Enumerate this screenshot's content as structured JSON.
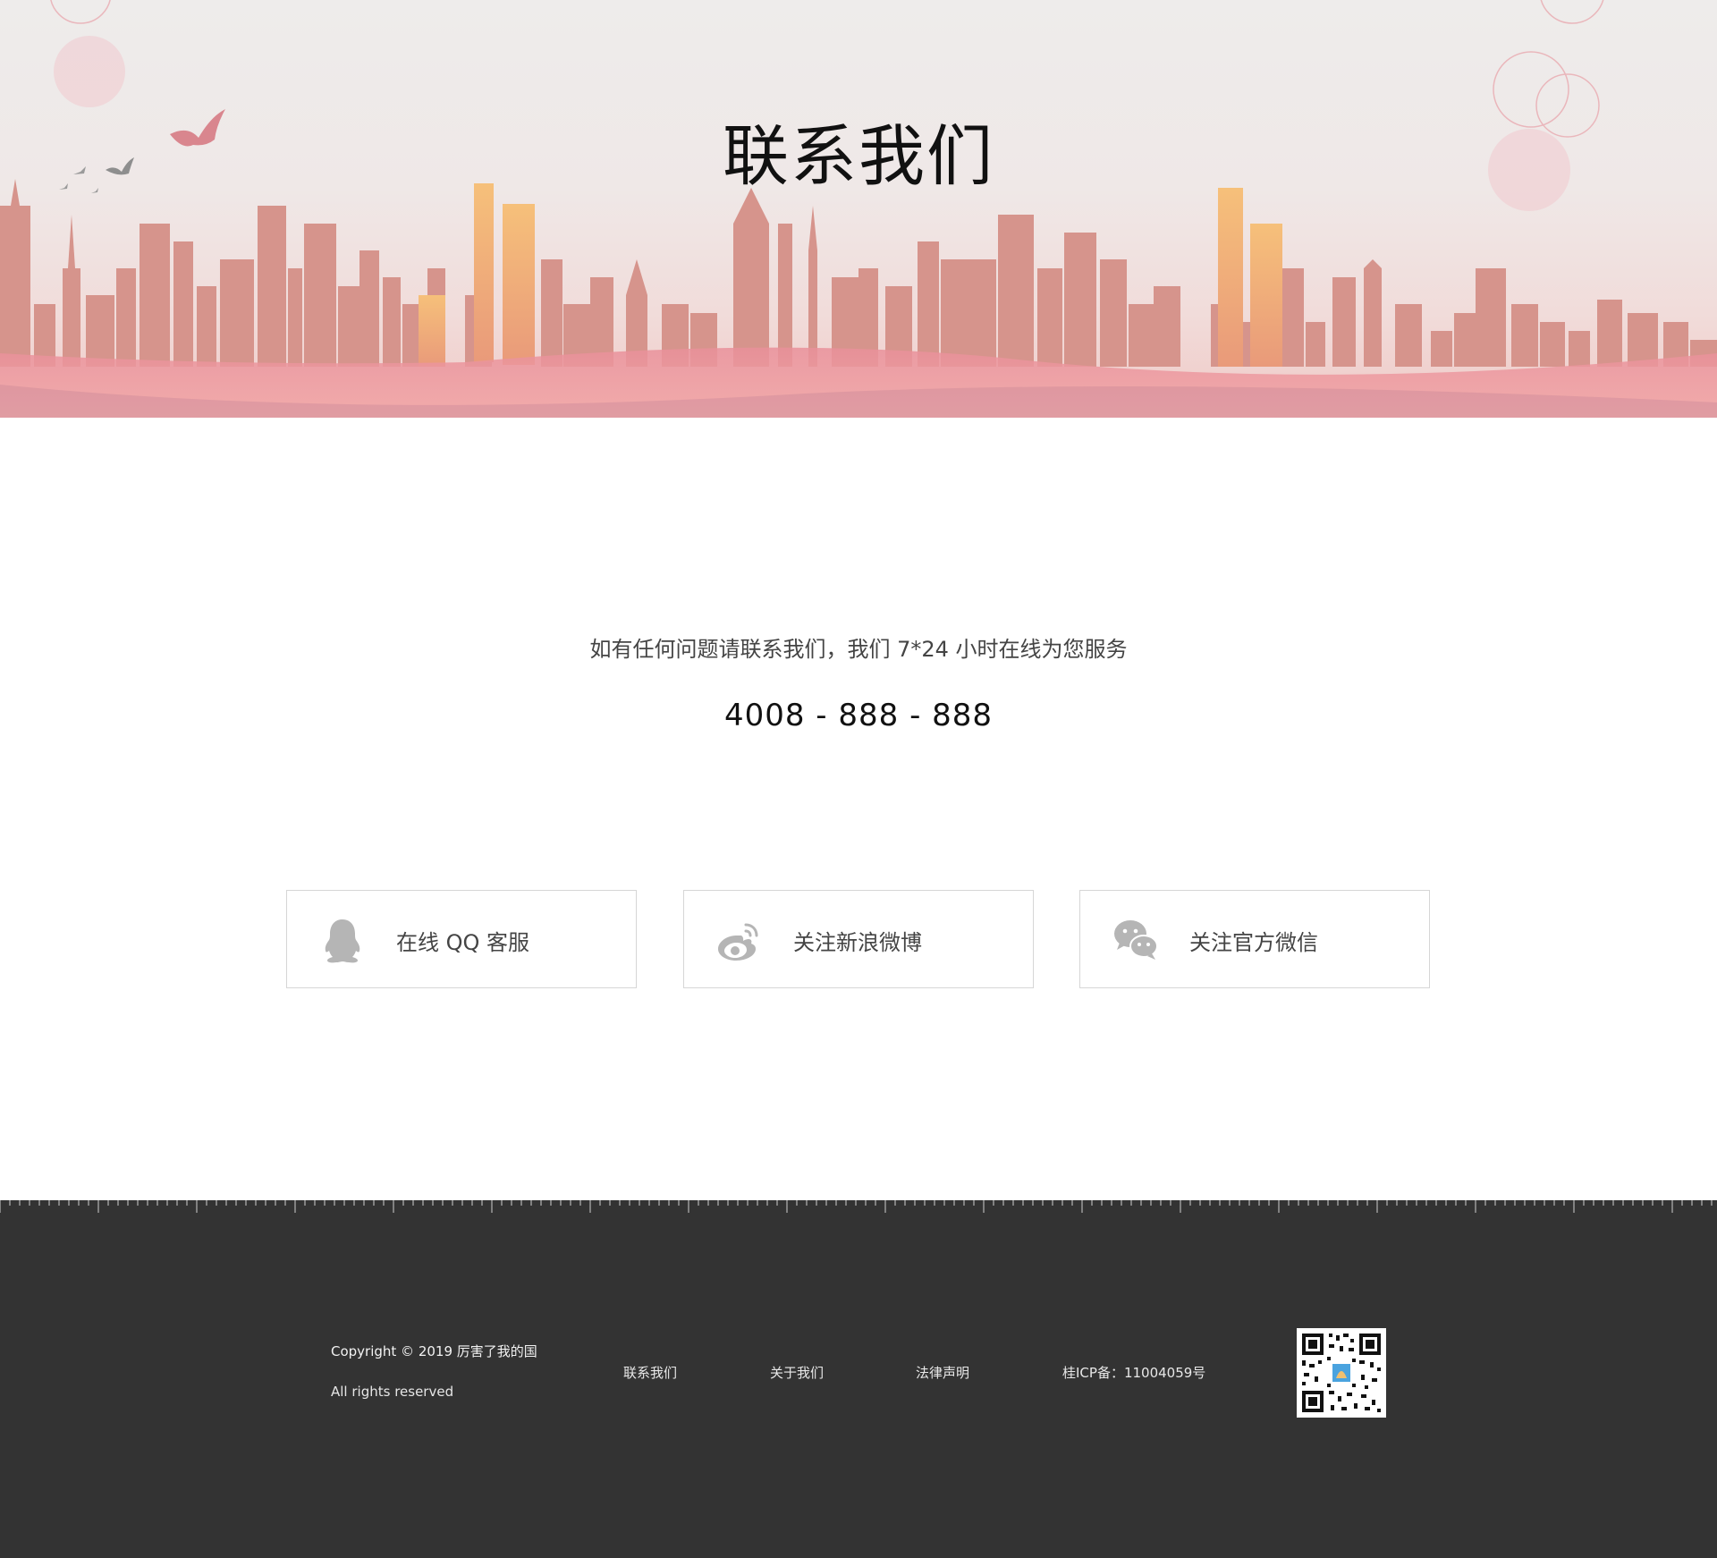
{
  "hero": {
    "title": "联系我们"
  },
  "contact": {
    "lead": "如有任何问题请联系我们，我们 7*24 小时在线为您服务",
    "phone": "4008 - 888 - 888"
  },
  "cards": [
    {
      "label": "在线 QQ 客服",
      "icon": "qq-penguin-icon"
    },
    {
      "label": "关注新浪微博",
      "icon": "weibo-icon"
    },
    {
      "label": "关注官方微信",
      "icon": "wechat-icon"
    }
  ],
  "footer": {
    "copyright": "Copyright © 2019 厉害了我的国",
    "rights": "All rights reserved",
    "links": [
      "联系我们",
      "关于我们",
      "法律声明"
    ],
    "icp": "桂ICP备：11004059号",
    "qr_icon": "qr-code-icon"
  },
  "colors": {
    "footer_bg": "#333333",
    "skyline": "#d08c86",
    "skyline_gold": "#f0b270",
    "icon_gray": "#b5b5b5"
  }
}
